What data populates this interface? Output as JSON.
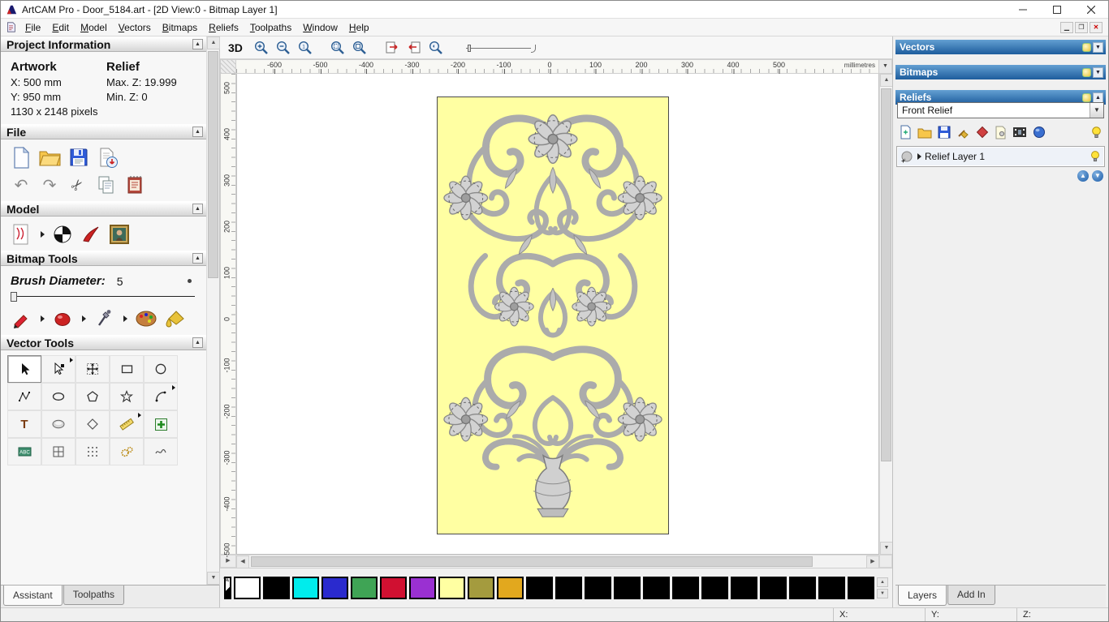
{
  "window": {
    "title": "ArtCAM Pro - Door_5184.art - [2D View:0 - Bitmap Layer 1]"
  },
  "menu": {
    "items": [
      "File",
      "Edit",
      "Model",
      "Vectors",
      "Bitmaps",
      "Reliefs",
      "Toolpaths",
      "Window",
      "Help"
    ]
  },
  "assistant": {
    "project_info": {
      "header": "Project Information",
      "artwork_label": "Artwork",
      "relief_label": "Relief",
      "artwork_x": "X: 500 mm",
      "artwork_y": "Y: 950 mm",
      "relief_max_z": "Max. Z: 19.999",
      "relief_min_z": "Min. Z: 0",
      "pixels": "1130 x 2148 pixels"
    },
    "file_header": "File",
    "model_header": "Model",
    "bitmap_tools_header": "Bitmap Tools",
    "brush": {
      "label": "Brush Diameter:",
      "value": "5"
    },
    "vector_tools_header": "Vector Tools",
    "tab_assistant": "Assistant",
    "tab_toolpaths": "Toolpaths"
  },
  "canvas_toolbar": {
    "view3d_label": "3D"
  },
  "ruler": {
    "h_ticks": [
      "-600",
      "-500",
      "-400",
      "-300",
      "-200",
      "-100",
      "0",
      "100",
      "200",
      "300",
      "400",
      "500"
    ],
    "v_ticks": [
      "500",
      "400",
      "300",
      "200",
      "100",
      "0",
      "-100",
      "-200",
      "-300",
      "-400",
      "-500"
    ],
    "units_label": "millimetres"
  },
  "right_panel": {
    "vectors_header": "Vectors",
    "bitmaps_header": "Bitmaps",
    "reliefs_header": "Reliefs",
    "relief_selector_value": "Front Relief",
    "layer": {
      "name": "Relief Layer 1"
    },
    "tab_layers": "Layers",
    "tab_addin": "Add In"
  },
  "status_bar": {
    "x_label": "X:",
    "y_label": "Y:",
    "z_label": "Z:"
  },
  "palette": {
    "swatches": [
      "#ffffff",
      "#000000",
      "#00ecec",
      "#2a2ace",
      "#3fa455",
      "#d01031",
      "#9a30d2",
      "#ffffa2",
      "#a49b3e",
      "#e2a81e",
      "#000000",
      "#000000",
      "#000000",
      "#000000",
      "#000000",
      "#000000",
      "#000000",
      "#000000",
      "#000000",
      "#000000",
      "#000000",
      "#000000"
    ]
  },
  "icon_glyphs": {
    "undo": "↶",
    "redo": "↷",
    "cut": "✂"
  },
  "colors": {
    "header_blue": "#1d5c9c",
    "canvas_yellow": "#ffffa2"
  }
}
